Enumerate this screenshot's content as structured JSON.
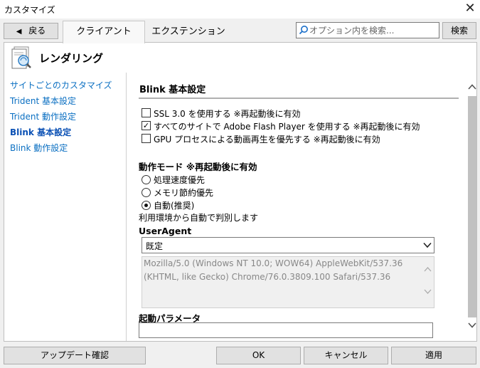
{
  "window": {
    "title": "カスタマイズ"
  },
  "toolbar": {
    "back_label": "戻る",
    "tabs": [
      "クライアント",
      "エクステンション"
    ],
    "search_placeholder": "オプション内を検索...",
    "search_button": "検索"
  },
  "section": {
    "title": "レンダリング"
  },
  "sidebar": {
    "items": [
      "サイトごとのカスタマイズ",
      "Trident 基本設定",
      "Trident 動作設定",
      "Blink 基本設定",
      "Blink 動作設定"
    ],
    "active_index": 3
  },
  "content": {
    "heading": "Blink 基本設定",
    "checkboxes": [
      {
        "label": "SSL 3.0 を使用する ※再起動後に有効",
        "checked": false
      },
      {
        "label": "すべてのサイトで Adobe Flash Player を使用する ※再起動後に有効",
        "checked": true
      },
      {
        "label": "GPU プロセスによる動画再生を優先する ※再起動後に有効",
        "checked": false
      }
    ],
    "mode_heading": "動作モード ※再起動後に有効",
    "mode_options": [
      {
        "label": "処理速度優先",
        "selected": false
      },
      {
        "label": "メモリ節約優先",
        "selected": false
      },
      {
        "label": "自動(推奨)",
        "selected": true
      }
    ],
    "mode_description": "利用環境から自動で判別します",
    "useragent_heading": "UserAgent",
    "useragent_select": "既定",
    "useragent_text_line1": "Mozilla/5.0 (Windows NT 10.0; WOW64) AppleWebKit/537.36",
    "useragent_text_line2": "(KHTML, like Gecko) Chrome/76.0.3809.100 Safari/537.36",
    "params_heading": "起動パラメータ",
    "params_value": ""
  },
  "footer": {
    "update_check": "アップデート確認",
    "ok": "OK",
    "cancel": "キャンセル",
    "apply": "適用"
  }
}
